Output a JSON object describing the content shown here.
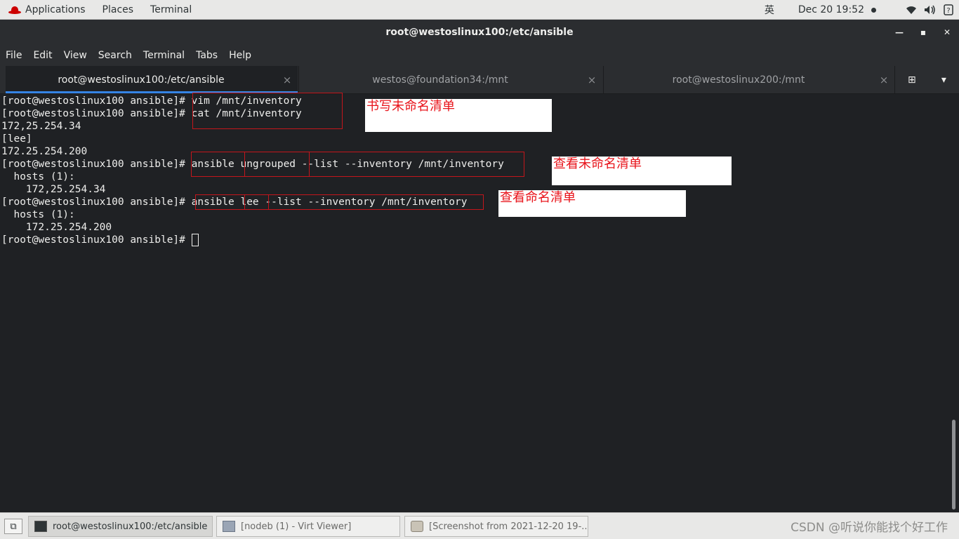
{
  "topbar": {
    "applications": "Applications",
    "places": "Places",
    "terminal": "Terminal",
    "input_method": "英",
    "clock": "Dec 20  19:52",
    "icons": [
      "redhat-icon",
      "wifi-icon",
      "volume-icon",
      "power-icon"
    ]
  },
  "window": {
    "title": "root@westoslinux100:/etc/ansible",
    "minimize": "—",
    "maximize": "▪",
    "close": "✕"
  },
  "menubar": {
    "items": [
      "File",
      "Edit",
      "View",
      "Search",
      "Terminal",
      "Tabs",
      "Help"
    ]
  },
  "tabs": [
    {
      "label": "root@westoslinux100:/etc/ansible",
      "active": true
    },
    {
      "label": "westos@foundation34:/mnt",
      "active": false
    },
    {
      "label": "root@westoslinux200:/mnt",
      "active": false
    }
  ],
  "tab_close": "×",
  "tab_tools": {
    "new_tab": "⊞",
    "menu": "▾"
  },
  "terminal": {
    "lines": [
      "[root@westoslinux100 ansible]# vim /mnt/inventory",
      "[root@westoslinux100 ansible]# cat /mnt/inventory",
      "172,25.254.34",
      "[lee]",
      "172.25.254.200",
      "[root@westoslinux100 ansible]# ansible ungrouped --list --inventory /mnt/inventory",
      "  hosts (1):",
      "    172,25.254.34",
      "[root@westoslinux100 ansible]# ansible lee --list --inventory /mnt/inventory",
      "  hosts (1):",
      "    172.25.254.200",
      "[root@westoslinux100 ansible]# "
    ]
  },
  "annotations": {
    "note1": "书写未命名清单",
    "note2": "查看未命名清单",
    "note3": "查看命名清单",
    "color": "#e8141b"
  },
  "taskbar": {
    "workspace": "⧉",
    "tasks": [
      {
        "label": "root@westoslinux100:/etc/ansible",
        "active": true
      },
      {
        "label": "[nodeb (1) - Virt Viewer]",
        "active": false
      },
      {
        "label": "[Screenshot from 2021-12-20 19-...",
        "active": false
      }
    ],
    "watermark": "CSDN @听说你能找个好工作"
  }
}
